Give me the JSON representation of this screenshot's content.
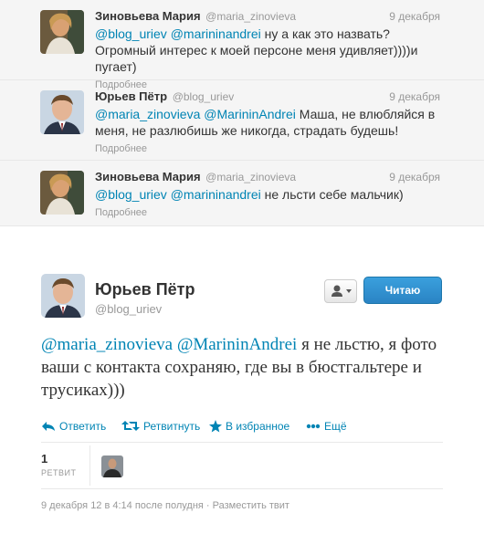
{
  "conversation": [
    {
      "fullname": "Зиновьева Мария",
      "username": "@maria_zinovieva",
      "time": "9 декабря",
      "mentions": [
        "@blog_uriev",
        "@marininandrei"
      ],
      "text": "ну а как это назвать? Огромный интерес к моей персоне меня удивляет))))и пугает)",
      "expand_label": "Подробнее"
    },
    {
      "fullname": "Юрьев Пётр",
      "username": "@blog_uriev",
      "time": "9 декабря",
      "mentions": [
        "@maria_zinovieva",
        "@MarininAndrei"
      ],
      "text": "Маша, не влюбляйся в меня, не разлюбишь же никогда, страдать будешь!",
      "expand_label": "Подробнее"
    },
    {
      "fullname": "Зиновьева Мария",
      "username": "@maria_zinovieva",
      "time": "9 декабря",
      "mentions": [
        "@blog_uriev",
        "@marininandrei"
      ],
      "text": "не льсти себе мальчик)",
      "expand_label": "Подробнее"
    }
  ],
  "main_tweet": {
    "fullname": "Юрьев Пётр",
    "username": "@blog_uriev",
    "follow_label": "Читаю",
    "mentions": [
      "@maria_zinovieva",
      "@MarininAndrei"
    ],
    "text": "я не льстю, я фото ваши с контакта сохраняю, где вы в бюстгальтере и трусиках)))",
    "actions": {
      "reply": "Ответить",
      "retweet": "Ретвитнуть",
      "favorite": "В избранное",
      "more": "Ещё"
    },
    "retweet_count": "1",
    "retweet_count_label": "РЕТВИТ",
    "timestamp": "9 декабря 12 в 4:14 после полудня",
    "separator": "·",
    "embed_label": "Разместить твит"
  },
  "icons": {
    "reply": "reply-arrow-icon",
    "retweet": "retweet-icon",
    "favorite": "star-icon",
    "more": "more-dots-icon",
    "person": "person-icon",
    "caret": "caret-down-icon"
  },
  "colors": {
    "link": "#0084b4",
    "follow_button": "#2a8ad0",
    "muted": "#999999",
    "conversation_bg": "#f5f5f5"
  }
}
